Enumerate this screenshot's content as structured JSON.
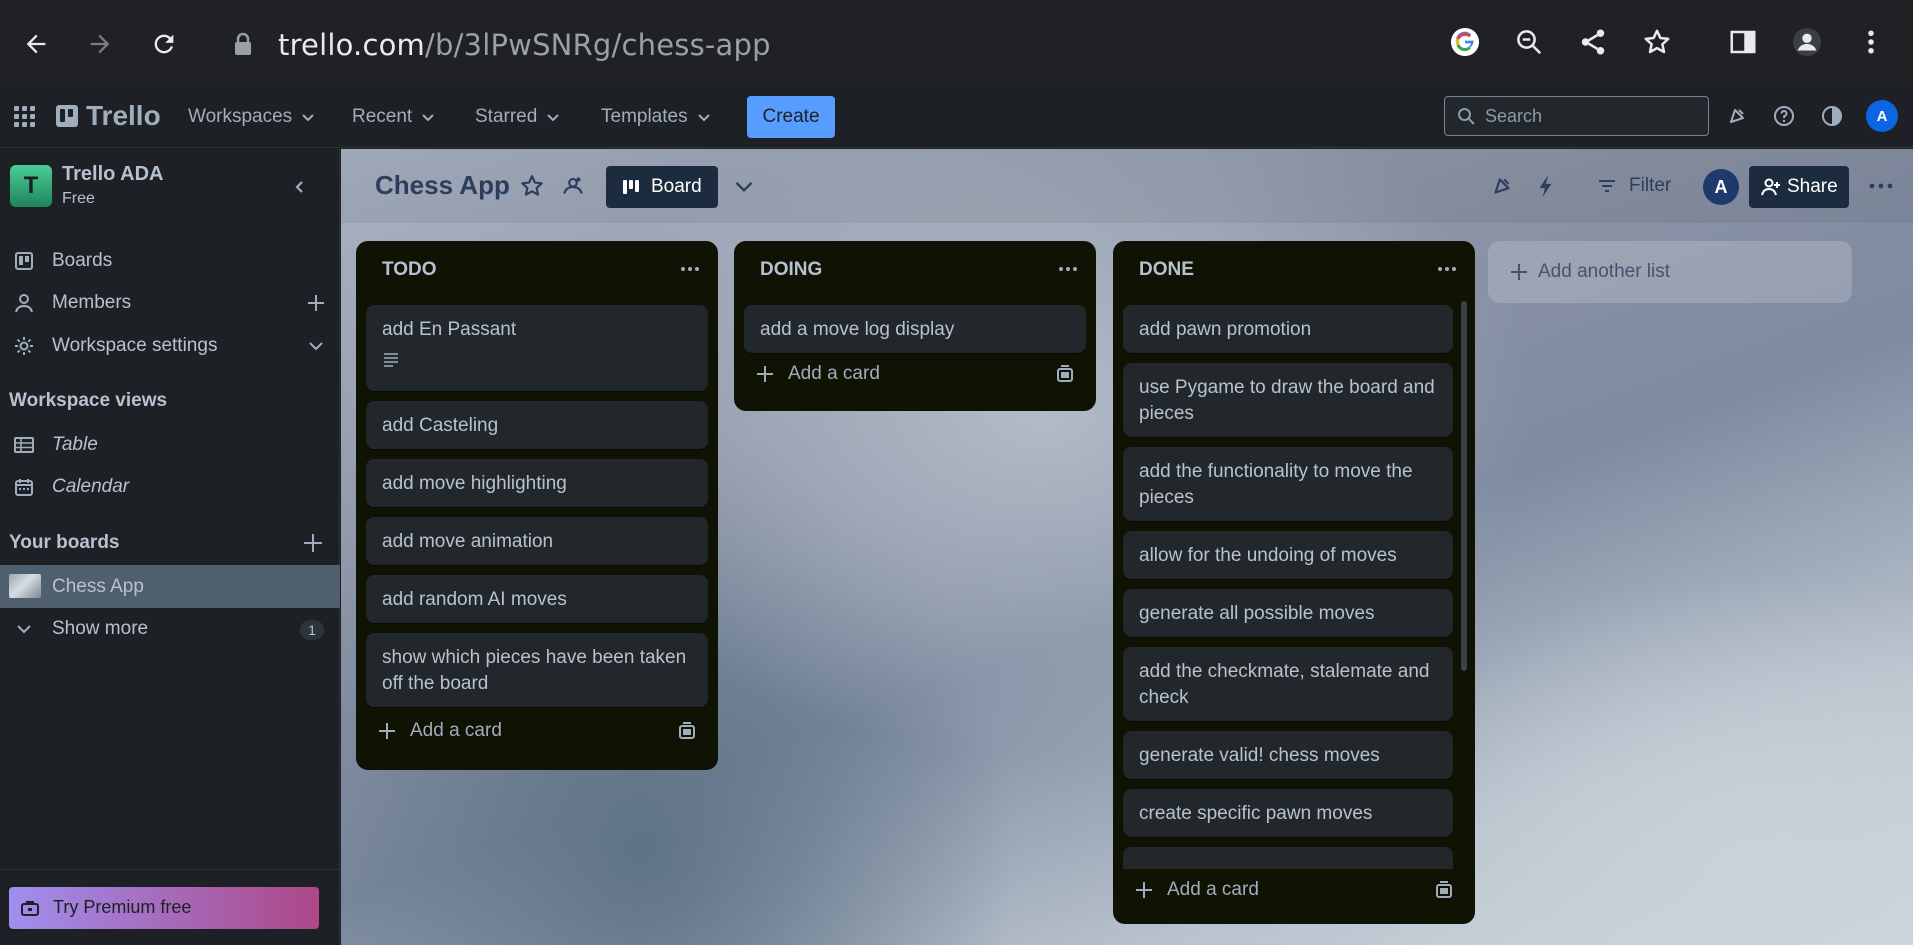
{
  "browser": {
    "url_host": "trello.com",
    "url_path": "/b/3lPwSNRg/chess-app",
    "icons": [
      "back-icon",
      "forward-icon",
      "reload-icon",
      "lock-icon",
      "google-icon",
      "zoom-out-icon",
      "share-icon",
      "star-icon",
      "sidepanel-icon",
      "profile-icon",
      "kebab-menu-icon"
    ]
  },
  "header": {
    "logo": "Trello",
    "menus": [
      {
        "label": "Workspaces"
      },
      {
        "label": "Recent"
      },
      {
        "label": "Starred"
      },
      {
        "label": "Templates"
      }
    ],
    "create_label": "Create",
    "search_placeholder": "Search",
    "avatar_initial": "A",
    "accent": "#579dff"
  },
  "sidebar": {
    "workspace_initial": "T",
    "workspace_name": "Trello ADA",
    "workspace_plan": "Free",
    "items": [
      {
        "label": "Boards"
      },
      {
        "label": "Members"
      },
      {
        "label": "Workspace settings"
      }
    ],
    "views_heading": "Workspace views",
    "views": [
      {
        "label": "Table"
      },
      {
        "label": "Calendar"
      }
    ],
    "boards_heading": "Your boards",
    "boards": [
      {
        "label": "Chess App"
      }
    ],
    "show_more_label": "Show more",
    "show_more_count": "1",
    "premium_label": "Try Premium free"
  },
  "board": {
    "title": "Chess App",
    "view_label": "Board",
    "filter_label": "Filter",
    "member_initial": "A",
    "share_label": "Share",
    "add_list_label": "Add another list",
    "lists": [
      {
        "title": "TODO",
        "cards": [
          {
            "text": "add En Passant"
          },
          {
            "text": "add Casteling"
          },
          {
            "text": "add move highlighting"
          },
          {
            "text": "add move animation"
          },
          {
            "text": "add random AI moves"
          },
          {
            "text": "show which pieces have been taken off the board"
          }
        ],
        "add_card_label": "Add a card"
      },
      {
        "title": "DOING",
        "cards": [
          {
            "text": "add a move log display"
          }
        ],
        "add_card_label": "Add a card"
      },
      {
        "title": "DONE",
        "cards": [
          {
            "text": "add pawn promotion"
          },
          {
            "text": "use Pygame to draw the board and pieces"
          },
          {
            "text": "add the functionality to move the pieces"
          },
          {
            "text": "allow for the undoing of moves"
          },
          {
            "text": "generate all possible moves"
          },
          {
            "text": "add the checkmate, stalemate and check"
          },
          {
            "text": "generate valid! chess moves"
          },
          {
            "text": "create specific pawn moves"
          }
        ],
        "add_card_label": "Add a card"
      }
    ]
  }
}
